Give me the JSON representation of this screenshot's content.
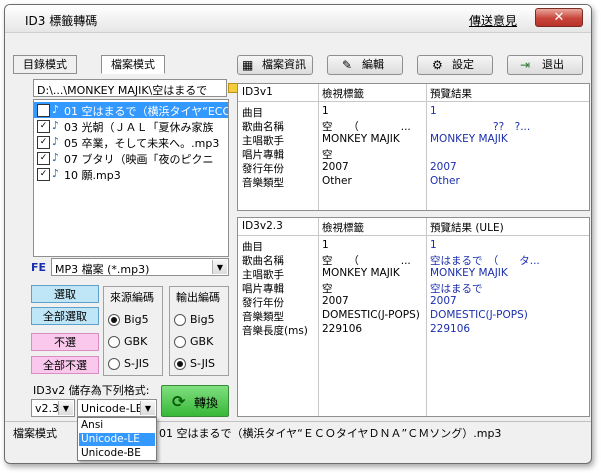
{
  "window": {
    "title": "ID3 標籤轉碼",
    "feedback_link": "傳送意見",
    "close_symbol": "✕"
  },
  "tabs": [
    {
      "label": "目錄模式"
    },
    {
      "label": "檔案模式"
    }
  ],
  "toolbar": {
    "file_info": "檔案資訊",
    "edit": "編輯",
    "settings": "設定",
    "exit": "退出"
  },
  "path": {
    "value": "D:\\...\\MONKEY MAJIK\\空はまるで"
  },
  "files": [
    {
      "name": "01 空はまるで（横浜タイヤ“ECO",
      "checked": true,
      "selected": true
    },
    {
      "name": "03 光朝（ＪＡＬ「夏休み家族",
      "checked": true,
      "selected": false
    },
    {
      "name": "05 卒業，そして未来へ。.mp3",
      "checked": true,
      "selected": false
    },
    {
      "name": "07 ブタリ（映画「夜のピクニ",
      "checked": true,
      "selected": false
    },
    {
      "name": "10 願.mp3",
      "checked": true,
      "selected": false
    }
  ],
  "filter": {
    "prefix": "FE",
    "value": "MP3 檔案 (*.mp3)"
  },
  "buttons": {
    "select": "選取",
    "select_all": "全部選取",
    "deselect": "不選",
    "deselect_all": "全部不選",
    "convert": "轉換"
  },
  "source_encoding": {
    "title": "來源編碼",
    "options": [
      "Big5",
      "GBK",
      "S-JIS"
    ],
    "selected": "Big5"
  },
  "output_encoding": {
    "title": "輸出編碼",
    "options": [
      "Big5",
      "GBK",
      "S-JIS"
    ],
    "selected": "S-JIS"
  },
  "save_format": {
    "label": "ID3v2 儲存為下列格式:",
    "version": "v2.3",
    "encoding": "Unicode-LE",
    "dropdown_options": [
      "Ansi",
      "Unicode-LE",
      "Unicode-BE"
    ],
    "dropdown_selected": "Unicode-LE"
  },
  "id3v1": {
    "headers": [
      "ID3v1",
      "檢視標籤",
      "預覽結果"
    ],
    "rows": [
      {
        "field": "曲目",
        "view": "1",
        "preview": "1"
      },
      {
        "field": "歌曲名稱",
        "view": "空　　（　　　　...",
        "preview": "　　　　　　??　?..."
      },
      {
        "field": "主唱歌手",
        "view": "MONKEY MAJIK",
        "preview": "MONKEY MAJIK"
      },
      {
        "field": "唱片專輯",
        "view": "空",
        "preview": ""
      },
      {
        "field": "發行年份",
        "view": "2007",
        "preview": "2007"
      },
      {
        "field": "音樂類型",
        "view": "Other",
        "preview": "Other"
      }
    ]
  },
  "id3v2": {
    "headers": [
      "ID3v2.3",
      "檢視標籤",
      "預覽結果 (ULE)"
    ],
    "rows": [
      {
        "field": "曲目",
        "view": "1",
        "preview": "1"
      },
      {
        "field": "歌曲名稱",
        "view": "空　　（　　　　...",
        "preview": "空はまるで　（　　タ..."
      },
      {
        "field": "主唱歌手",
        "view": "MONKEY MAJIK",
        "preview": "MONKEY MAJIK"
      },
      {
        "field": "唱片專輯",
        "view": "空",
        "preview": "空はまるで"
      },
      {
        "field": "發行年份",
        "view": "2007",
        "preview": "2007"
      },
      {
        "field": "音樂類型",
        "view": "DOMESTIC(J-POPS)",
        "preview": "DOMESTIC(J-POPS)"
      },
      {
        "field": "音樂長度(ms)",
        "view": "229106",
        "preview": "229106"
      }
    ]
  },
  "status": {
    "left": "檔案模式",
    "text": "01 空はまるで（横浜タイヤ“ＥＣＯタイヤＤＮＡ”ＣＭソング）.mp3"
  },
  "colors": {
    "accent_blue": "#1b2fae",
    "selection": "#3399ff",
    "convert_green": "#38b838"
  }
}
